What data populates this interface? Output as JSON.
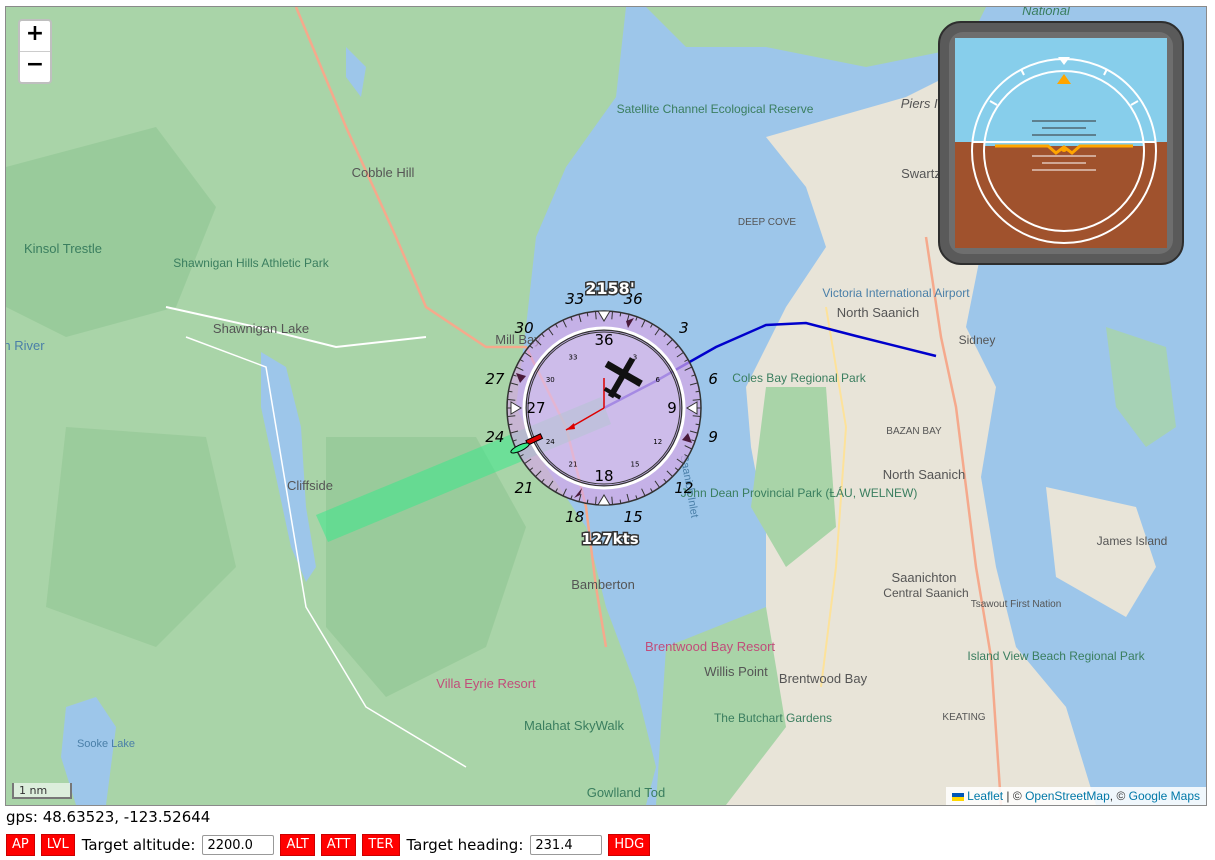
{
  "map": {
    "zoom_in": "+",
    "zoom_out": "−",
    "scale_label": "1 nm",
    "altitude_readout": "2158'",
    "speed_readout": "127kts",
    "compass_outer": [
      "36",
      "3",
      "6",
      "9",
      "12",
      "15",
      "18",
      "21",
      "24",
      "27",
      "30",
      "33"
    ],
    "compass_inner": [
      "36",
      "9",
      "18",
      "27"
    ],
    "compass_small": [
      "3",
      "6",
      "12",
      "15",
      "21",
      "24",
      "30",
      "33"
    ],
    "place_labels": {
      "cobble_hill": "Cobble Hill",
      "kinsol_trestle": "Kinsol Trestle",
      "shawnigan_park": "Shawnigan Hills Athletic Park",
      "shawnigan_lake": "Shawnigan Lake",
      "mill_bay": "Mill Bay",
      "cliffside": "Cliffside",
      "bamberton": "Bamberton",
      "villa_eyrie": "Villa Eyrie Resort",
      "malahat_skywalk": "Malahat SkyWalk",
      "gowlland_tod": "Gowlland Tod",
      "sooke_lake": "Sooke Lake",
      "satellite_channel": "Satellite Channel Ecological Reserve",
      "piers_island": "Piers I.",
      "swartz_bay": "Swartz",
      "deep_cove": "DEEP COVE",
      "victoria_airport": "Victoria International Airport",
      "north_saanich": "North Saanich",
      "sidney": "Sidney",
      "coles_bay": "Coles Bay Regional Park",
      "bazan_bay": "BAZAN BAY",
      "john_dean": "John Dean Provincial Park (ȽÁU, WELNEW)",
      "saanichton": "Saanichton",
      "central_saanich": "Central Saanich",
      "brentwood_resort": "Brentwood Bay Resort",
      "willis_point": "Willis Point",
      "brentwood_bay": "Brentwood Bay",
      "butchart": "The Butchart Gardens",
      "island_view": "Island View Beach Regional Park",
      "james_island": "James Island",
      "tsawout": "Tsawout First Nation",
      "keating": "KEATING",
      "saanich_inlet": "Saanich Inlet",
      "river": "n River",
      "national": "National"
    }
  },
  "attribution": {
    "leaflet": "Leaflet",
    "sep1": " | © ",
    "osm": "OpenStreetMap",
    "sep2": ", © ",
    "google": "Google Maps"
  },
  "gps": {
    "label": "gps:",
    "value": "48.63523, -123.52644"
  },
  "controls": {
    "ap": "AP",
    "lvl": "LVL",
    "target_altitude_label": "Target altitude:",
    "target_altitude_value": "2200.0",
    "alt": "ALT",
    "att": "ATT",
    "ter": "TER",
    "target_heading_label": "Target heading:",
    "target_heading_value": "231.4",
    "hdg": "HDG"
  },
  "colors": {
    "water": "#9dc6ea",
    "land": "#a9d4a8",
    "track": "#0000cc",
    "button_red": "#ff0000",
    "sky": "#87ceeb",
    "ground": "#a0522d",
    "horizon": "#ffa500"
  }
}
